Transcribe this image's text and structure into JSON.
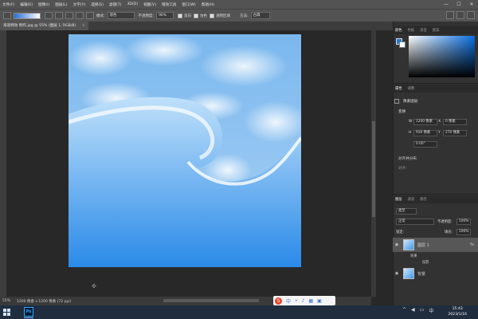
{
  "menubar": {
    "items": [
      "文件(F)",
      "编辑(E)",
      "图像(I)",
      "图层(L)",
      "文字(Y)",
      "选择(S)",
      "滤镜(T)",
      "3D(D)",
      "视图(V)",
      "增效工具",
      "窗口(W)",
      "帮助(H)"
    ]
  },
  "window_controls": {
    "minimize": "—",
    "maximize": "☐",
    "close": "✕"
  },
  "options_bar": {
    "mode_label": "模式:",
    "mode_value": "溶色",
    "opacity_label": "不透明度:",
    "opacity_value": "90%",
    "reverse_label": "反向",
    "dither_label": "仿色",
    "transparency_label": "透明区域",
    "method_label": "方法:",
    "method_value": "古典"
  },
  "document_tab": {
    "title": "海浪特效 制作.jpg @ 55% (图层 1, RGB/8)",
    "close": "×"
  },
  "canvas": {
    "cursor_glyph": "✣"
  },
  "status_bar": {
    "zoom": "55%",
    "doc_info": "1200 像素 x 1200 像素 (72 ppi)"
  },
  "color_panel": {
    "tabs": [
      "颜色",
      "色板",
      "渐变",
      "图案"
    ],
    "fg_color": "#1d7ad8",
    "bg_color": "#ffffff"
  },
  "properties_panel": {
    "tabs": [
      "属性",
      "调整"
    ],
    "layer_kind": "像素图层",
    "transform_label": "变换",
    "w_label": "W",
    "w_value": "1200 像素",
    "x_label": "X",
    "x_value": "0 像素",
    "h_label": "H",
    "h_value": "930 像素",
    "y_label": "Y",
    "y_value": "270 像素",
    "angle_value": "0.00°",
    "align_label": "对齐并分布",
    "align_sub": "对齐:"
  },
  "layers_panel": {
    "tabs": [
      "图层",
      "通道",
      "路径"
    ],
    "filter_value": "类型",
    "blend_value": "正常",
    "opacity_label": "不透明度:",
    "opacity_value": "100%",
    "lock_label": "锁定:",
    "fill_label": "填充:",
    "fill_value": "100%",
    "layers": [
      {
        "name": "图层 1",
        "fx": "fx",
        "effects_label": "效果",
        "effect_item": "投影"
      },
      {
        "name": "背景"
      }
    ]
  },
  "taskbar": {
    "app_label": "Ps",
    "time": "15:43",
    "date": "2023/1/16",
    "lang": "中",
    "ime_logo": "S"
  }
}
